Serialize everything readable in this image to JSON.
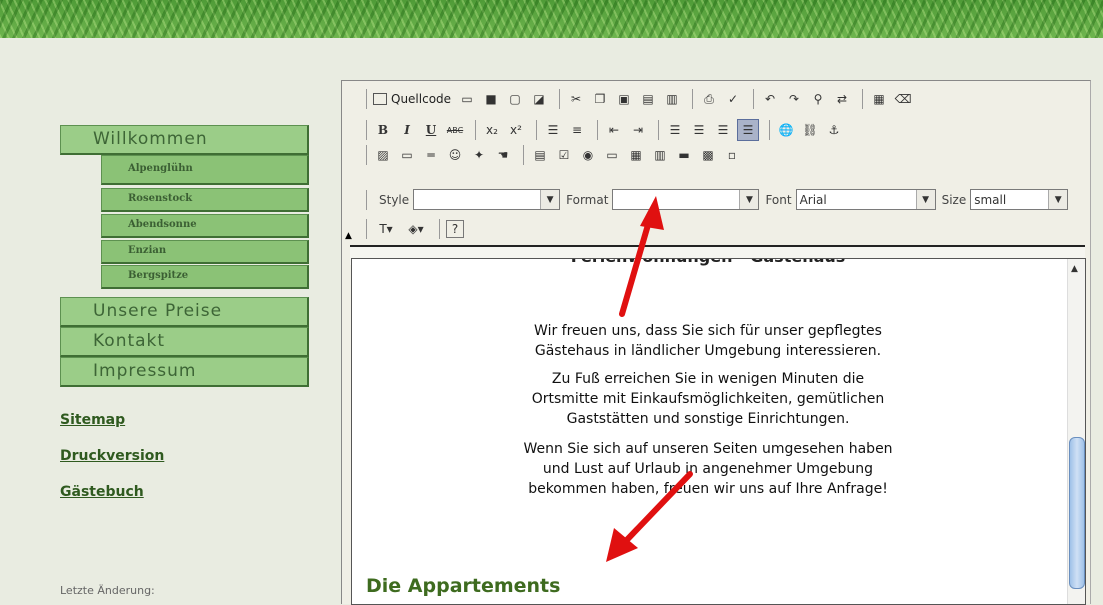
{
  "sidebar": {
    "menu": [
      "Willkommen",
      "Unsere Preise",
      "Kontakt",
      "Impressum"
    ],
    "submenu": [
      "Alpenglühn",
      "Rosenstock",
      "Abendsonne",
      "Enzian",
      "Bergspitze"
    ],
    "links": [
      "Sitemap",
      "Druckversion",
      "Gästebuch"
    ],
    "footer": "Letzte Änderung:"
  },
  "editor": {
    "toolbar": {
      "quellcode": "Quellcode",
      "style_label": "Style",
      "style_value": "",
      "format_label": "Format",
      "format_value": "",
      "font_label": "Font",
      "font_value": "Arial",
      "size_label": "Size",
      "size_value": "small",
      "bold": "B",
      "italic": "I",
      "underline": "U",
      "help": "?"
    },
    "content": {
      "partial_heading": "Ferienwohnungen - Gästehaus",
      "paragraphs": [
        [
          "Wir freuen uns, dass Sie sich für unser gepflegtes",
          "Gästehaus in ländlicher Umgebung interessieren."
        ],
        [
          "Zu Fuß erreichen Sie in wenigen Minuten die",
          "Ortsmitte mit Einkaufsmöglichkeiten, gemütlichen",
          "Gaststätten und sonstige Einrichtungen."
        ],
        [
          "Wenn Sie sich auf unseren Seiten umgesehen haben",
          "und Lust auf Urlaub in angenehmer Umgebung",
          "bekommen haben, freuen wir uns auf Ihre Anfrage!"
        ]
      ],
      "heading": "Die Appartements"
    }
  },
  "colors": {
    "menu_bg": "#9bcd88",
    "menu_text": "#3d6536",
    "heading": "#3e6b1f",
    "arrow": "#e01010"
  }
}
